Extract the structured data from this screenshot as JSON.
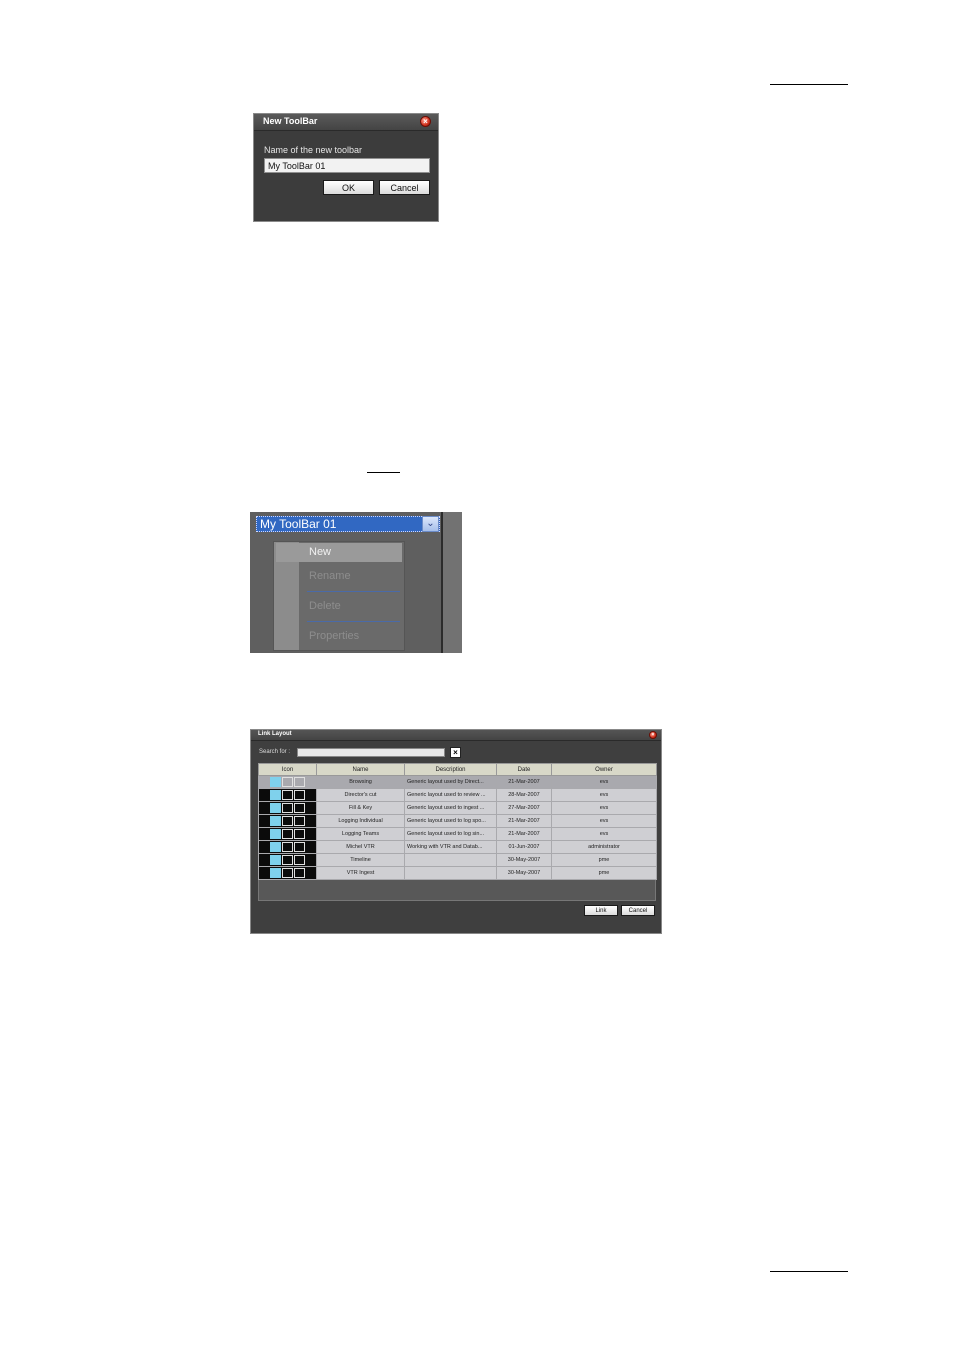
{
  "new_toolbar_dialog": {
    "title": "New ToolBar",
    "field_label": "Name of the new toolbar",
    "field_value": "My ToolBar 01",
    "ok_label": "OK",
    "cancel_label": "Cancel"
  },
  "toolbar_dropdown": {
    "selected": "My ToolBar 01",
    "menu": [
      "New",
      "Rename",
      "Delete",
      "Properties"
    ]
  },
  "link_layout_dialog": {
    "title": "Link Layout",
    "search_label": "Search for :",
    "columns": [
      "Icon",
      "Name",
      "Description",
      "Date",
      "Owner"
    ],
    "rows": [
      {
        "name": "Browsing",
        "description": "Generic layout used by Direct...",
        "date": "21-Mar-2007",
        "owner": "evs"
      },
      {
        "name": "Director's cut",
        "description": "Generic layout used to review ...",
        "date": "28-Mar-2007",
        "owner": "evs"
      },
      {
        "name": "Fill & Key",
        "description": "Generic layout used to ingest ...",
        "date": "27-Mar-2007",
        "owner": "evs"
      },
      {
        "name": "Logging Individual",
        "description": "Generic layout used to log spo...",
        "date": "21-Mar-2007",
        "owner": "evs"
      },
      {
        "name": "Logging Teams",
        "description": "Generic layout used to log sin...",
        "date": "21-Mar-2007",
        "owner": "evs"
      },
      {
        "name": "Michel VTR",
        "description": "Working with VTR and Datab...",
        "date": "01-Jun-2007",
        "owner": "administrator"
      },
      {
        "name": "Timeline",
        "description": "",
        "date": "30-May-2007",
        "owner": "pme"
      },
      {
        "name": "VTR Ingest",
        "description": "",
        "date": "30-May-2007",
        "owner": "pme"
      }
    ],
    "link_label": "Link",
    "cancel_label": "Cancel"
  }
}
